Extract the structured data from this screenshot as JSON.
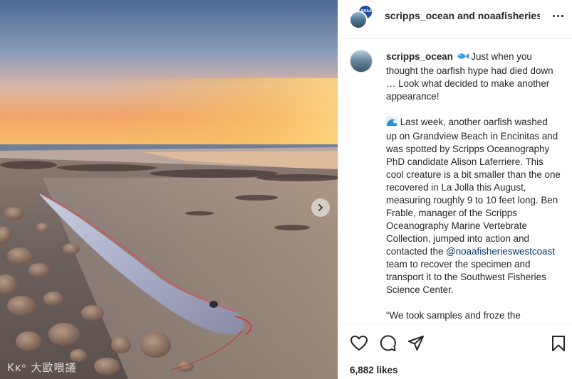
{
  "header": {
    "users": "scripps_ocean and noaafisherieswestcoast",
    "more_icon": "more-horizontal-icon"
  },
  "caption": {
    "username": "scripps_ocean",
    "para1_emoji": "fish-icon",
    "para1": "Just when you thought the oarfish hype had died down … Look what decided to make another appearance!",
    "para2_emoji": "wave-icon",
    "para2_a": "Last week, another oarfish washed up on Grandview Beach in Encinitas and was spotted by Scripps Oceanography PhD candidate Alison Laferriere. This cool creature is a bit smaller than the one recovered in La Jolla this August, measuring roughly 9 to 10 feet long. Ben Frable, manager of the Scripps Oceanography Marine Vertebrate Collection, jumped into action and contacted the",
    "mention": "@noaafisherieswestcoast",
    "para2_b": "team to recover the specimen and transport it to the Southwest Fisheries Science Center.",
    "para3_partial": "“We took samples and froze the"
  },
  "actions": {
    "like_icon": "heart-icon",
    "comment_icon": "comment-icon",
    "share_icon": "send-icon",
    "save_icon": "bookmark-icon",
    "likes": "6,882 likes"
  },
  "photo": {
    "alt_subject": "oarfish on beach at sunset",
    "next_icon": "chevron-right-icon",
    "watermark": "Kĸᵒ 大歐喂議"
  },
  "colors": {
    "link": "#00376b",
    "text": "#262626",
    "border": "#efefef"
  }
}
